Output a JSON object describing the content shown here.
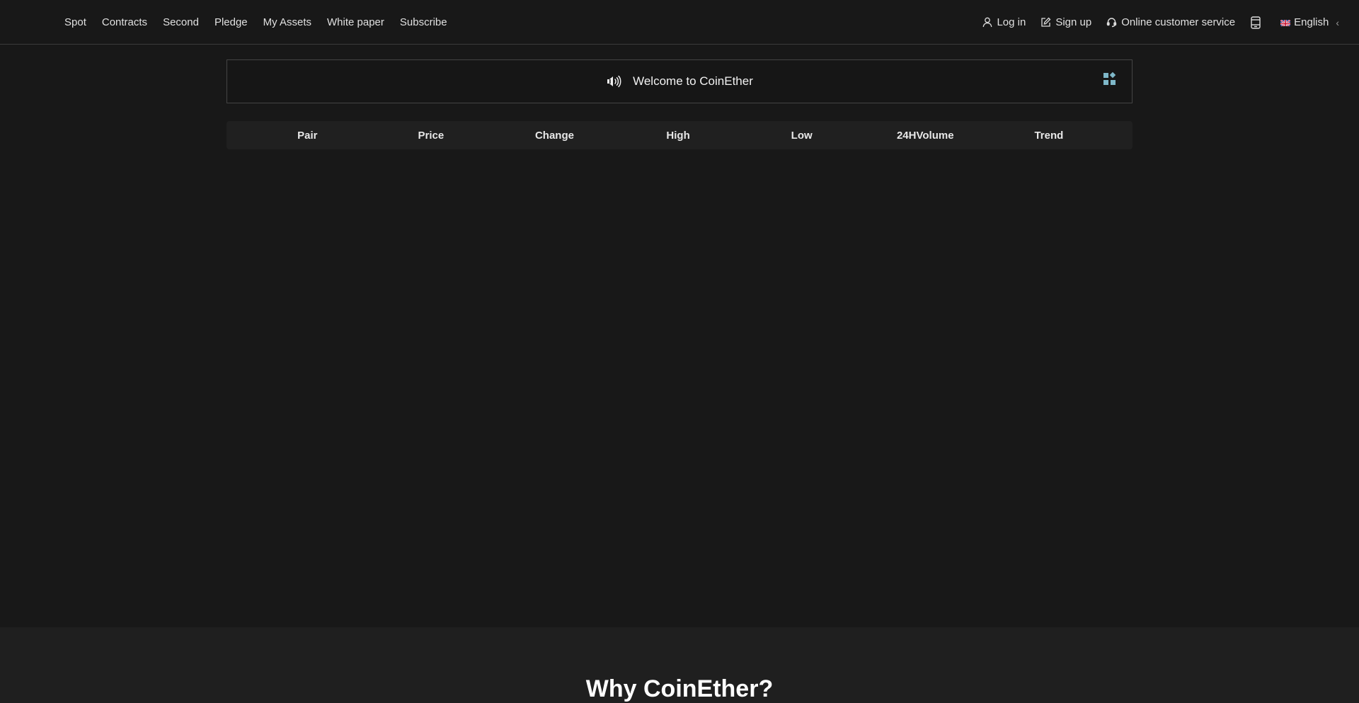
{
  "nav": {
    "items": [
      {
        "label": "Spot"
      },
      {
        "label": "Contracts"
      },
      {
        "label": "Second"
      },
      {
        "label": "Pledge"
      },
      {
        "label": "My Assets"
      },
      {
        "label": "White paper"
      },
      {
        "label": "Subscribe"
      }
    ],
    "login_label": "Log in",
    "signup_label": "Sign up",
    "service_label": "Online customer service",
    "language_label": "English",
    "login_icon": "user-icon",
    "signup_icon": "edit-icon",
    "service_icon": "headset-icon",
    "app_icon": "mobile-app-icon",
    "language_icon": "uk-flag-icon"
  },
  "notice": {
    "text": "Welcome to CoinEther",
    "icon": "speaker-icon",
    "menu_icon": "apps-grid-icon",
    "menu_icon_color": "#7fb8c9"
  },
  "market_table": {
    "columns": [
      "Pair",
      "Price",
      "Change",
      "High",
      "Low",
      "24HVolume",
      "Trend"
    ],
    "rows": []
  },
  "why": {
    "title": "Why CoinEther?"
  },
  "colors": {
    "background": "#181818",
    "section_background": "#1f1f1f",
    "header_row": "#202020",
    "text": "#e6e6e6"
  }
}
